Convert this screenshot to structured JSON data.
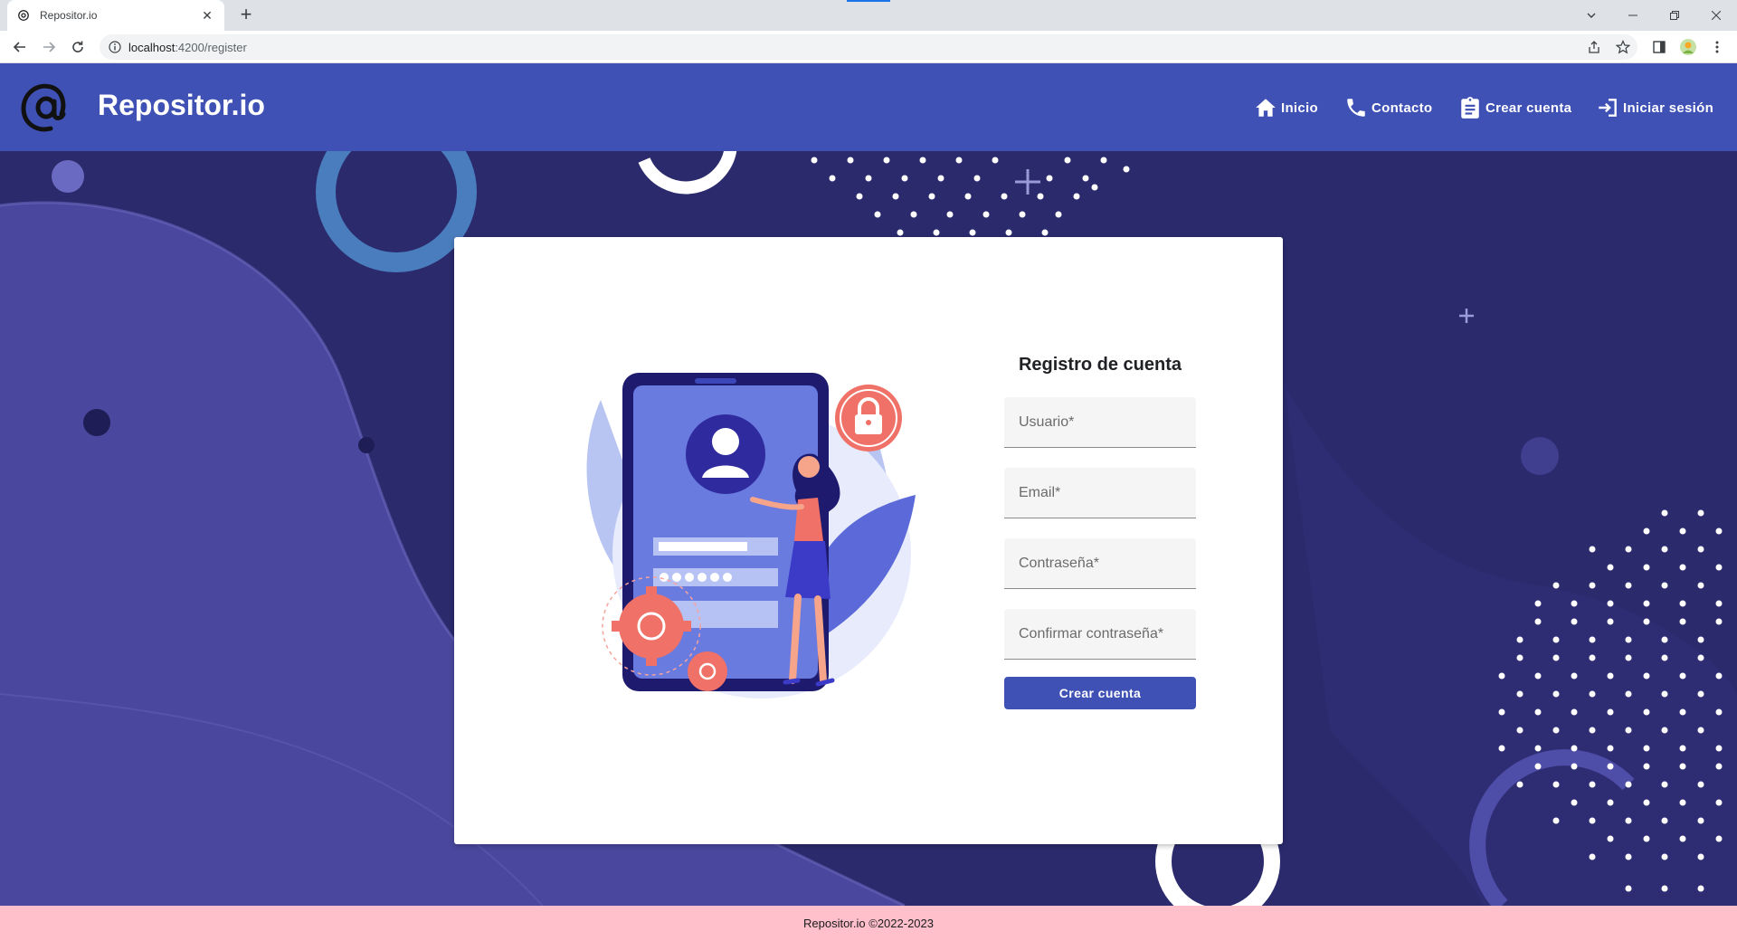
{
  "browser": {
    "tab_title": "Repositor.io",
    "url_host": "localhost",
    "url_path": ":4200/register"
  },
  "header": {
    "brand": "Repositor.io",
    "nav": {
      "home": "Inicio",
      "contact": "Contacto",
      "register": "Crear cuenta",
      "login": "Iniciar sesión"
    }
  },
  "form": {
    "title": "Registro de cuenta",
    "username_placeholder": "Usuario*",
    "email_placeholder": "Email*",
    "password_placeholder": "Contraseña*",
    "confirm_placeholder": "Confirmar contraseña*",
    "submit_label": "Crear cuenta"
  },
  "footer": {
    "text": "Repositor.io ©2022-2023"
  },
  "colors": {
    "primary": "#3f51b5",
    "background": "#2b2a6d",
    "footer": "#ffc0cb",
    "accent": "#f07167"
  }
}
